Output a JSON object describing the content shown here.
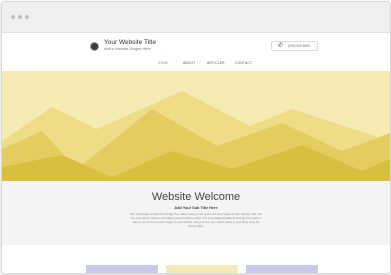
{
  "window": {
    "traffic_lights": [
      "dot",
      "dot",
      "dot"
    ]
  },
  "header": {
    "site_title": "Your Website Title",
    "slogan": "Add a Website Slogan Here",
    "phone_icon": "phone-icon",
    "phone_number": "(555) 555-5555"
  },
  "nav": {
    "items": [
      "HOME",
      "ABOUT",
      "ARTICLES",
      "CONTACT"
    ],
    "active_index": 0
  },
  "hero": {
    "background_color": "#f6ebb3",
    "mountain_colors": [
      "#eedc87",
      "#e4cd5e",
      "#d9bf3f"
    ]
  },
  "welcome": {
    "title": "Website Welcome",
    "subtitle": "Add Your Sub Title Here",
    "body": "This homepage template for Portage Pro makes it easy to set up the text and images of your website. Add your text, then switch colors to your liking using the theme editor. This homepage template for Portage Pro makes it easy to set up the text and images of your website. Add your text, then switch colors to your liking using the theme editor."
  },
  "cards": {
    "colors": [
      "#c9c9ee",
      "#f3eab8",
      "#c9c9ee"
    ]
  },
  "colors": {
    "accent": "#5aa6d6",
    "text_dark": "#333333"
  }
}
